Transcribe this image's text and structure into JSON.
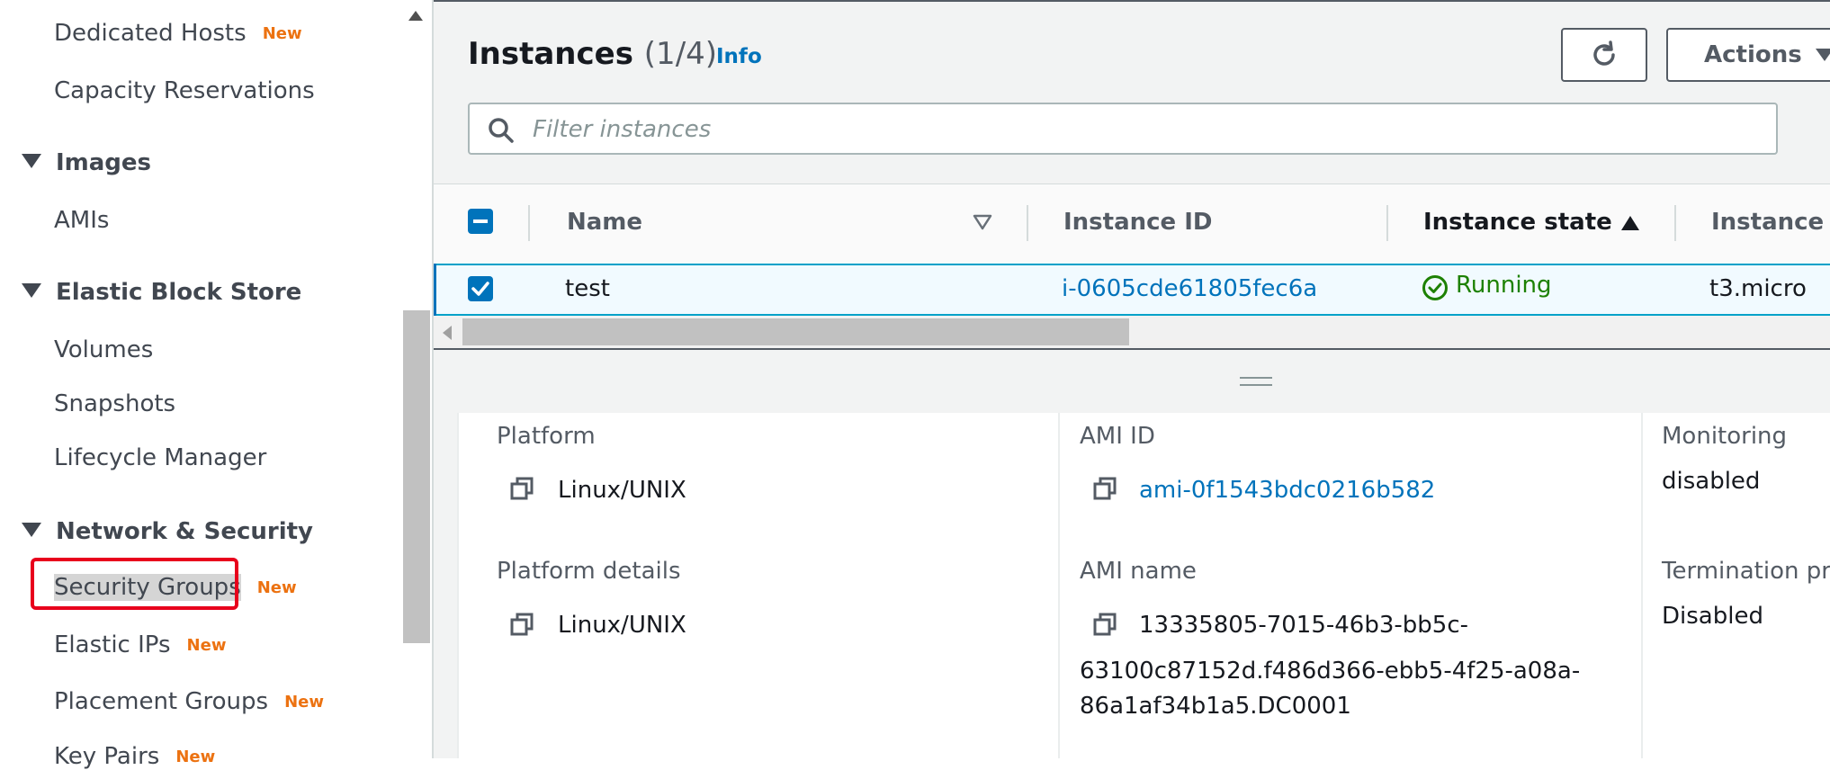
{
  "sidebar": {
    "items_top": [
      {
        "label": "Dedicated Hosts",
        "badge": "New"
      },
      {
        "label": "Capacity Reservations",
        "badge": ""
      }
    ],
    "images": {
      "heading": "Images",
      "items": [
        "AMIs"
      ]
    },
    "ebs": {
      "heading": "Elastic Block Store",
      "items": [
        "Volumes",
        "Snapshots",
        "Lifecycle Manager"
      ]
    },
    "network": {
      "heading": "Network & Security",
      "items": [
        {
          "label": "Security Groups",
          "badge": "New"
        },
        {
          "label": "Elastic IPs",
          "badge": "New"
        },
        {
          "label": "Placement Groups",
          "badge": "New"
        },
        {
          "label": "Key Pairs",
          "badge": "New"
        }
      ]
    }
  },
  "header": {
    "title": "Instances",
    "count": "(1/4)",
    "info": "Info",
    "actions": "Actions"
  },
  "search": {
    "placeholder": "Filter instances",
    "value": ""
  },
  "table": {
    "columns": [
      "Name",
      "Instance ID",
      "Instance state",
      "Instance ty"
    ],
    "rows": [
      {
        "name": "test",
        "instance_id": "i-0605cde61805fec6a",
        "state": "Running",
        "type": "t3.micro"
      }
    ]
  },
  "details": {
    "platform_label": "Platform",
    "platform_value": "Linux/UNIX",
    "platform_details_label": "Platform details",
    "platform_details_value": "Linux/UNIX",
    "ami_id_label": "AMI ID",
    "ami_id_value": "ami-0f1543bdc0216b582",
    "ami_name_label": "AMI name",
    "ami_name_line1": "13335805-7015-46b3-bb5c-",
    "ami_name_line2": "63100c87152d.f486d366-ebb5-4f25-a08a-",
    "ami_name_line3": "86a1af34b1a5.DC0001",
    "monitoring_label": "Monitoring",
    "monitoring_value": "disabled",
    "termination_label": "Termination pr",
    "termination_value": "Disabled"
  },
  "colors": {
    "accent": "#0073bb",
    "running": "#1d8102",
    "new_badge": "#ec7211",
    "highlight": "#e8001c"
  }
}
